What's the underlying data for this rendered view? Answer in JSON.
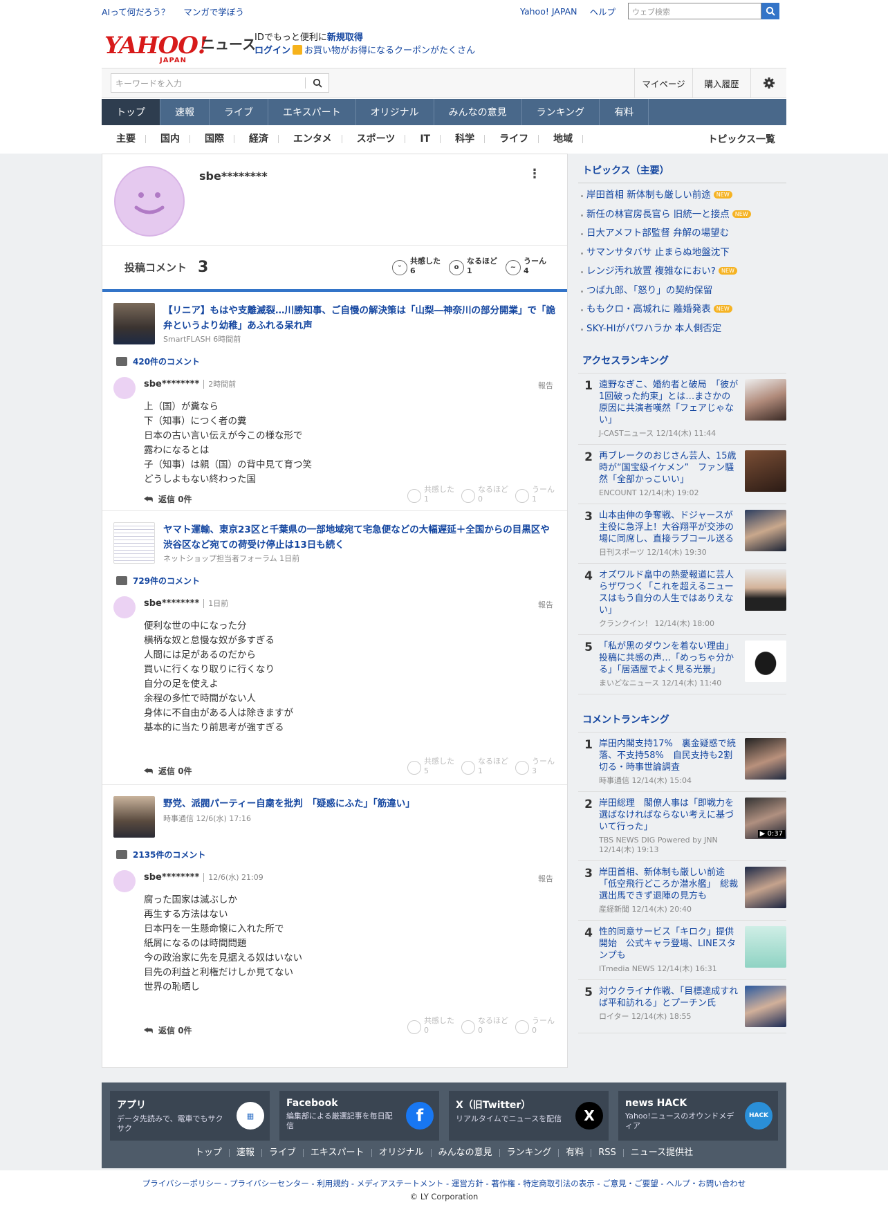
{
  "topbar": {
    "left": [
      "AIって何だろう？",
      "マンガで学ぼう"
    ],
    "right": [
      "Yahoo! JAPAN",
      "ヘルプ"
    ],
    "search_placeholder": "ウェブ検索"
  },
  "header": {
    "logo": "YAHOO!",
    "logo_sub": "JAPAN",
    "site": "ニュース",
    "line1_pre": "IDでもっと便利に",
    "line1_link": "新規取得",
    "line2_link": "ログイン",
    "line2_text": "お買い物がお得になるクーポンがたくさん"
  },
  "search": {
    "placeholder": "キーワードを入力",
    "mypage": "マイページ",
    "history": "購入履歴"
  },
  "nav": [
    "トップ",
    "速報",
    "ライブ",
    "エキスパート",
    "オリジナル",
    "みんなの意見",
    "ランキング",
    "有料"
  ],
  "subnav": [
    "主要",
    "国内",
    "国際",
    "経済",
    "エンタメ",
    "スポーツ",
    "IT",
    "科学",
    "ライフ",
    "地域"
  ],
  "topics_all": "トピックス一覧",
  "profile": {
    "name": "sbe********",
    "comments_label": "投稿コメント",
    "comments_count": "3",
    "reacts": [
      {
        "label": "共感した",
        "n": "6"
      },
      {
        "label": "なるほど",
        "n": "1"
      },
      {
        "label": "うーん",
        "n": "4"
      }
    ]
  },
  "posts": [
    {
      "title": "【リニア】もはや支離滅裂…川勝知事、ご自慢の解決策は「山梨―神奈川の部分開業」で「詭弁というより幼稚」あふれる呆れ声",
      "source": "SmartFLASH 6時間前",
      "ccount": "420件のコメント",
      "user": "sbe********",
      "time": "2時間前",
      "report": "報告",
      "body": "上（国）が糞なら\n下（知事）につく者の糞\n日本の古い言い伝えが今この様な形で\n露わになるとは\n子（知事）は親（国）の背中見て育つ笑\nどうしよもない終わった国",
      "reply": "返信 0件",
      "r": [
        {
          "l": "共感した",
          "n": "1"
        },
        {
          "l": "なるほど",
          "n": "0"
        },
        {
          "l": "うーん",
          "n": "1"
        }
      ]
    },
    {
      "title": "ヤマト運輸、東京23区と千葉県の一部地域宛て宅急便などの大幅遅延＋全国からの目黒区や渋谷区など宛ての荷受け停止は13日も続く",
      "source": "ネットショップ担当者フォーラム 1日前",
      "ccount": "729件のコメント",
      "user": "sbe********",
      "time": "1日前",
      "report": "報告",
      "body": "便利な世の中になった分\n横柄な奴と怠慢な奴が多すぎる\n人間には足があるのだから\n買いに行くなり取りに行くなり\n自分の足を使えよ\n余程の多忙で時間がない人\n身体に不自由がある人は除きますが\n基本的に当たり前思考が強すぎる",
      "reply": "返信 0件",
      "r": [
        {
          "l": "共感した",
          "n": "5"
        },
        {
          "l": "なるほど",
          "n": "1"
        },
        {
          "l": "うーん",
          "n": "3"
        }
      ]
    },
    {
      "title": "野党、派閥パーティー自粛を批判　「疑惑にふた」「筋違い」",
      "source": "時事通信 12/6(水) 17:16",
      "ccount": "2135件のコメント",
      "user": "sbe********",
      "time": "12/6(水) 21:09",
      "report": "報告",
      "body": "腐った国家は滅ぶしか\n再生する方法はない\n日本円を一生懸命懐に入れた所で\n紙屑になるのは時間問題\n今の政治家に先を見据える奴はいない\n目先の利益と利権だけしか見てない\n世界の恥晒し",
      "reply": "返信 0件",
      "r": [
        {
          "l": "共感した",
          "n": "0"
        },
        {
          "l": "なるほど",
          "n": "0"
        },
        {
          "l": "うーん",
          "n": "0"
        }
      ]
    }
  ],
  "topics": {
    "title": "トピックス（主要）",
    "items": [
      {
        "t": "岸田首相 新体制も厳しい前途",
        "new": "NEW"
      },
      {
        "t": "新任の林官房長官ら 旧統一と接点",
        "new": "NEW"
      },
      {
        "t": "日大アメフト部監督 弁解の場望む",
        "new": ""
      },
      {
        "t": "サマンサタバサ 止まらぬ地盤沈下",
        "new": ""
      },
      {
        "t": "レンジ汚れ放置 複雑なにおい?",
        "new": "NEW"
      },
      {
        "t": "つば九郎、「怒り」の契約保留",
        "new": ""
      },
      {
        "t": "ももクロ・高城れに 離婚発表",
        "new": "NEW"
      },
      {
        "t": "SKY-HIがパワハラか 本人側否定",
        "new": ""
      }
    ]
  },
  "access": {
    "title": "アクセスランキング",
    "items": [
      {
        "n": "1",
        "t": "遠野なぎこ、婚約者と破局　「彼が1回破った約束」とは…まさかの原因に共演者嘆然「フェアじゃない」",
        "s": "J-CASTニュース 12/14(木) 11:44"
      },
      {
        "n": "2",
        "t": "再ブレークのおじさん芸人、15歳時が“国宝級イケメン”　ファン騒然「全部かっこいい」",
        "s": "ENCOUNT 12/14(木) 19:02"
      },
      {
        "n": "3",
        "t": "山本由伸の争奪戦、ドジャースが主役に急浮上！大谷翔平が交渉の場に同席し、直接ラブコール送る",
        "s": "日刊スポーツ 12/14(木) 19:30"
      },
      {
        "n": "4",
        "t": "オズワルド畠中の熱愛報道に芸人らザワつく「これを超えるニュースはもう自分の人生ではありえない」",
        "s": "クランクイン！ 12/14(木) 18:00"
      },
      {
        "n": "5",
        "t": "「私が黒のダウンを着ない理由」投稿に共感の声…「めっちゃ分かる」「居酒屋でよく見る光景」",
        "s": "まいどなニュース 12/14(木) 11:40"
      }
    ]
  },
  "commentrank": {
    "title": "コメントランキング",
    "items": [
      {
        "n": "1",
        "t": "岸田内閣支持17%　裏金疑惑で続落、不支持58%　自民支持も2割切る・時事世論調査",
        "s": "時事通信 12/14(木) 15:04"
      },
      {
        "n": "2",
        "t": "岸田総理　閣僚人事は「即戦力を選ばなければならない考えに基づいて行った」",
        "s": "TBS NEWS DIG Powered by JNN 12/14(木) 19:13",
        "badge": "▶ 0:37"
      },
      {
        "n": "3",
        "t": "岸田首相、新体制も厳しい前途　「低空飛行どころか潜水艦」　総裁選出馬できず退陣の見方も",
        "s": "産経新聞 12/14(木) 20:40"
      },
      {
        "n": "4",
        "t": "性的同意サービス「キロク」提供開始　公式キャラ登場、LINEスタンプも",
        "s": "ITmedia NEWS 12/14(木) 16:31"
      },
      {
        "n": "5",
        "t": "対ウクライナ作戦、「目標達成すれば平和訪れる」とプーチン氏",
        "s": "ロイター 12/14(木) 18:55"
      }
    ]
  },
  "footer": {
    "cards": [
      {
        "h": "アプリ",
        "d": "データ先読みで、電車でもサクサク"
      },
      {
        "h": "Facebook",
        "d": "編集部による厳選記事を毎日配信"
      },
      {
        "h": "X（旧Twitter）",
        "d": "リアルタイムでニュースを配信"
      },
      {
        "h": "news HACK",
        "d": "Yahoo!ニュースのオウンドメディア"
      }
    ],
    "links": [
      "トップ",
      "速報",
      "ライブ",
      "エキスパート",
      "オリジナル",
      "みんなの意見",
      "ランキング",
      "有料",
      "RSS",
      "ニュース提供社"
    ],
    "legal": "プライバシーポリシー - プライバシーセンター - 利用規約 - メディアステートメント - 運営方針 - 著作権 - 特定商取引法の表示 - ご意見・ご要望 - ヘルプ・お問い合わせ",
    "copy": "© LY Corporation"
  }
}
